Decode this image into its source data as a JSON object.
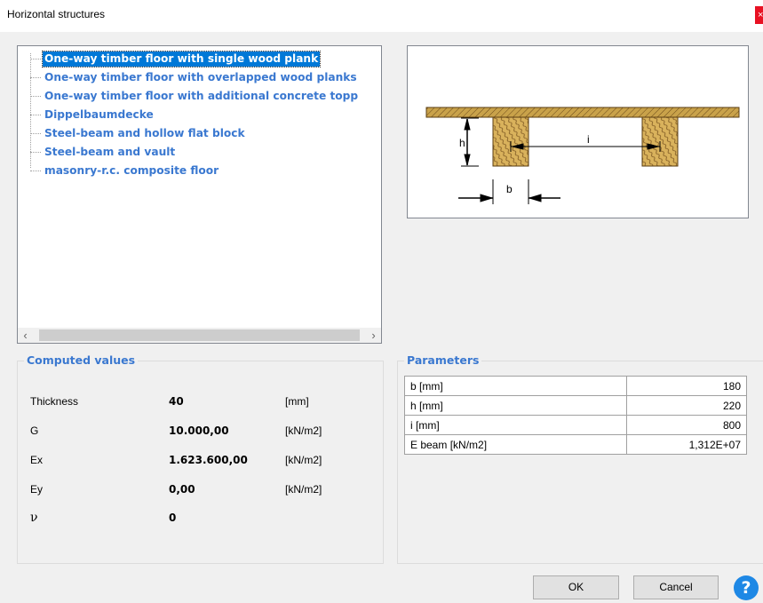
{
  "window": {
    "title": "Horizontal structures",
    "close_glyph": "×"
  },
  "tree": {
    "items": [
      {
        "label": "One-way timber floor with single wood plank",
        "selected": true
      },
      {
        "label": "One-way timber floor with overlapped wood planks",
        "selected": false
      },
      {
        "label": "One-way timber floor with additional concrete topp",
        "selected": false
      },
      {
        "label": "Dippelbaumdecke",
        "selected": false
      },
      {
        "label": "Steel-beam and hollow flat block",
        "selected": false
      },
      {
        "label": "Steel-beam and vault",
        "selected": false
      },
      {
        "label": "masonry-r.c. composite floor",
        "selected": false
      }
    ],
    "scroll_left_glyph": "‹",
    "scroll_right_glyph": "›"
  },
  "figure": {
    "label_h": "h",
    "label_i": "i",
    "label_b": "b"
  },
  "computed": {
    "title": "Computed values",
    "rows": [
      {
        "label": "Thickness",
        "value": "40",
        "unit": "[mm]"
      },
      {
        "label": "G",
        "value": "10.000,00",
        "unit": "[kN/m2]"
      },
      {
        "label": "Ex",
        "value": "1.623.600,00",
        "unit": "[kN/m2]"
      },
      {
        "label": "Ey",
        "value": "0,00",
        "unit": "[kN/m2]"
      },
      {
        "label": "ν",
        "value": "0",
        "unit": ""
      }
    ]
  },
  "parameters": {
    "title": "Parameters",
    "rows": [
      {
        "label": "b [mm]",
        "value": "180"
      },
      {
        "label": "h [mm]",
        "value": "220"
      },
      {
        "label": "i [mm]",
        "value": "800"
      },
      {
        "label": "E beam [kN/m2]",
        "value": "1,312E+07"
      }
    ]
  },
  "buttons": {
    "ok": "OK",
    "cancel": "Cancel",
    "help": "?"
  },
  "icons": {
    "help": "question-circle-icon",
    "close": "close-icon"
  },
  "colors": {
    "accent": "#3a78d0",
    "selection": "#0078d7",
    "help": "#1e88e5",
    "close": "#e81123",
    "wood": "#c8a046"
  }
}
